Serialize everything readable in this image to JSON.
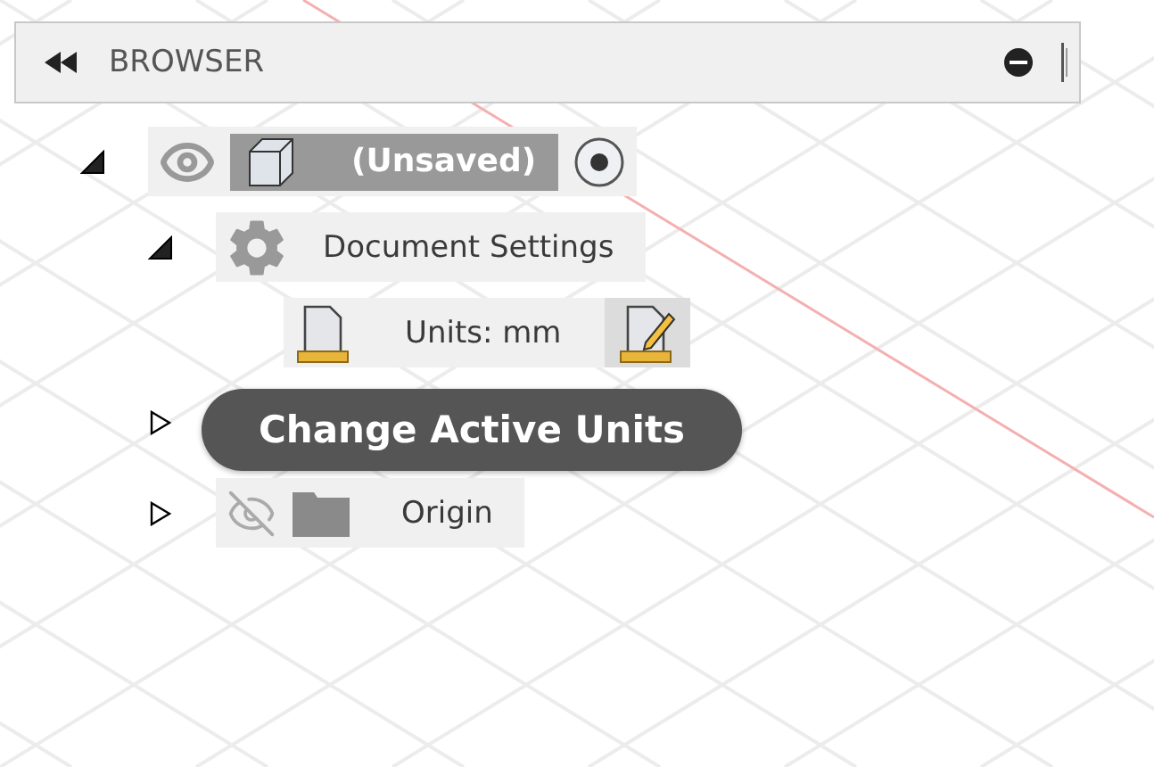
{
  "panel": {
    "title": "BROWSER"
  },
  "tree": [
    {
      "kind": "component",
      "label": "(Unsaved)",
      "expanded": true,
      "visible": true,
      "selected": true,
      "active": true,
      "children": [
        {
          "kind": "settings",
          "label": "Document Settings",
          "expanded": true,
          "children": [
            {
              "kind": "units",
              "label": "Units: mm"
            }
          ]
        },
        {
          "kind": "covered",
          "expanded": false
        },
        {
          "kind": "folder",
          "label": "Origin",
          "expanded": false,
          "visible": false
        }
      ]
    }
  ],
  "tooltip": {
    "text": "Change Active Units"
  }
}
